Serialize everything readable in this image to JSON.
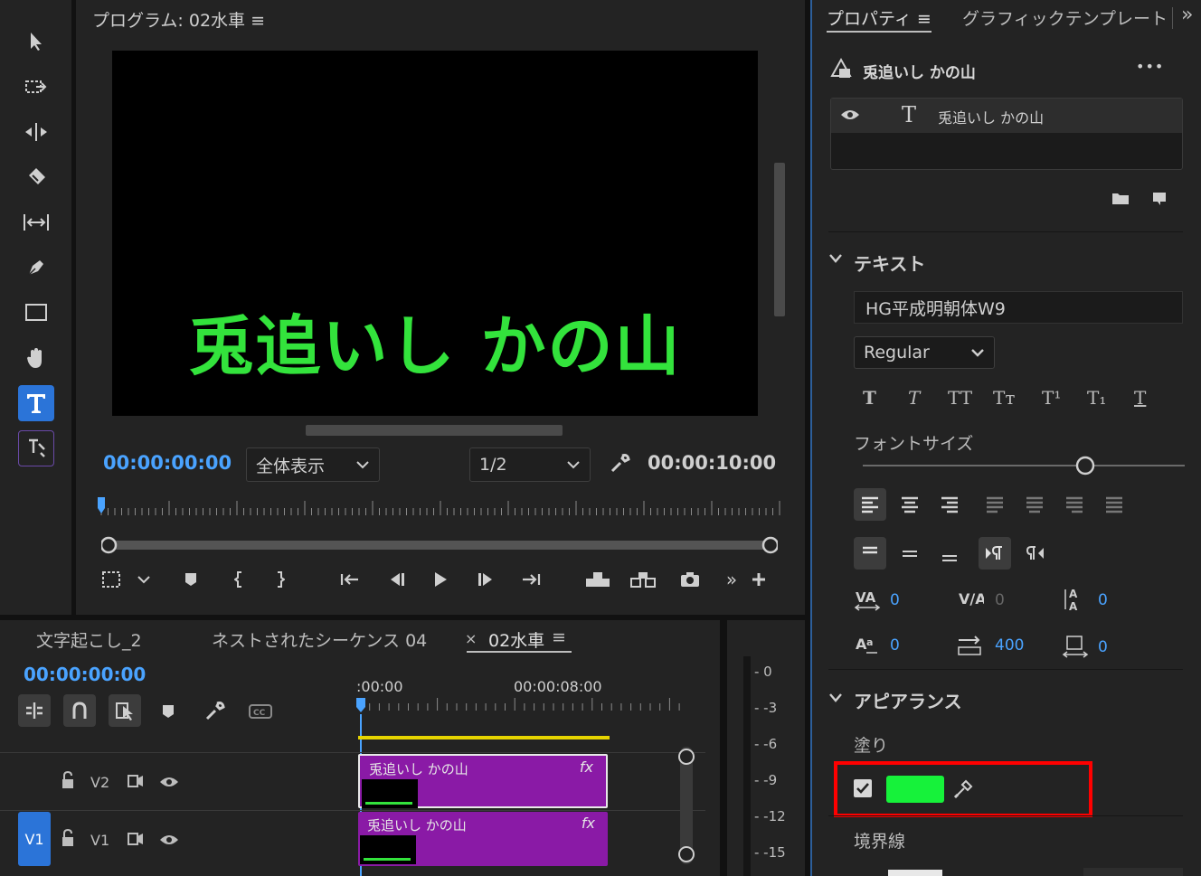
{
  "monitor": {
    "title": "プログラム: 02水車 ≡",
    "video_text": "兎追いし かの山",
    "timecode_current": "00:00:00:00",
    "zoom_label": "全体表示",
    "resolution": "1/2",
    "timecode_duration": "00:00:10:00"
  },
  "properties": {
    "tab_properties": "プロパティ ≡",
    "tab_graphic_templates": "グラフィックテンプレート",
    "tab_overflow": "»",
    "more_label": "•••",
    "layer_title": "兎追いし かの山",
    "layer_item": "兎追いし かの山",
    "section_text": "テキスト",
    "font_family": "HG平成明朝体W9",
    "font_style": "Regular",
    "font_size_label": "フォントサイズ",
    "font_size_slider": 0.7,
    "kerning": "0",
    "tracking": "0",
    "leading": "0",
    "baseline_shift": "0",
    "tsume": "400",
    "tab_width": "0",
    "section_appearance": "アピアランス",
    "fill_label": "塗り",
    "fill_checked": true,
    "fill_color": "#16f23a",
    "stroke_label": "境界線",
    "text_styles": [
      "T",
      "T",
      "TT",
      "Tт",
      "T¹",
      "T₁",
      "T"
    ]
  },
  "timeline": {
    "tab1": "文字起こし_2",
    "tab2": "ネストされたシーケンス 04",
    "tab3_close": "×",
    "tab3": "02水車",
    "tab3_menu": "≡",
    "timecode": "00:00:00:00",
    "ruler_start": ":00:00",
    "ruler_mid": "00:00:08:00",
    "track_v2": "V2",
    "track_v1": "V1",
    "track_v1_target": "V1",
    "clip_v2_label": "兎追いし かの山",
    "clip_v1_label": "兎追いし かの山",
    "clip_fx": "fx"
  },
  "meter": {
    "labels": [
      "0",
      "-3",
      "-6",
      "-9",
      "-12",
      "-15"
    ]
  },
  "colors": {
    "accent_blue": "#4aa3ff",
    "clip_purple": "#8a1aa6",
    "title_green": "#33e33c",
    "highlight_red": "#ff0000",
    "work_area_yellow": "#e6d400"
  }
}
